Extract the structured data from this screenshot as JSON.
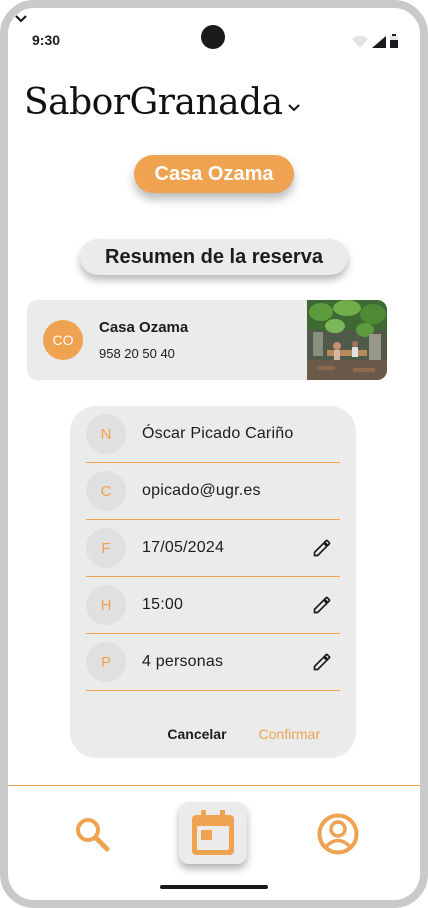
{
  "status_bar": {
    "time": "9:30"
  },
  "header": {
    "app_title": "SaborGranada"
  },
  "restaurant_pill": {
    "label": "Casa Ozama"
  },
  "section": {
    "title": "Resumen de la reserva"
  },
  "restaurant_card": {
    "avatar_initials": "CO",
    "name": "Casa Ozama",
    "phone": "958 20 50 40"
  },
  "reservation": {
    "rows": [
      {
        "letter": "N",
        "value": "Óscar Picado Cariño",
        "editable": false
      },
      {
        "letter": "C",
        "value": "opicado@ugr.es",
        "editable": false
      },
      {
        "letter": "F",
        "value": "17/05/2024",
        "editable": true
      },
      {
        "letter": "H",
        "value": "15:00",
        "editable": true
      },
      {
        "letter": "P",
        "value": "4 personas",
        "editable": true
      }
    ],
    "cancel_label": "Cancelar",
    "confirm_label": "Confirmar"
  },
  "nav": {
    "items": [
      {
        "icon": "search-icon"
      },
      {
        "icon": "calendar-icon",
        "active": true
      },
      {
        "icon": "account-circle-icon"
      }
    ]
  },
  "colors": {
    "accent": "#efa24f",
    "surface": "#ebebeb",
    "text": "#1d1b20"
  }
}
